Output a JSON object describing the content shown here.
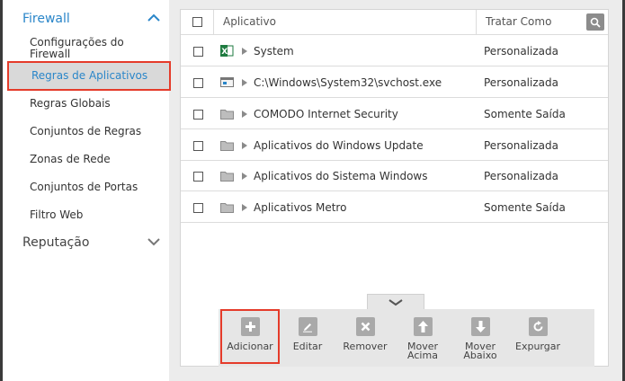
{
  "sidebar": {
    "firewall_title": "Firewall",
    "items": [
      {
        "label": "Configurações do Firewall"
      },
      {
        "label": "Regras de Aplicativos"
      },
      {
        "label": "Regras Globais"
      },
      {
        "label": "Conjuntos de Regras"
      },
      {
        "label": "Zonas de Rede"
      },
      {
        "label": "Conjuntos de Portas"
      },
      {
        "label": "Filtro Web"
      }
    ],
    "reputation_title": "Reputação"
  },
  "table": {
    "col_app": "Aplicativo",
    "col_treat": "Tratar Como",
    "rows": [
      {
        "name": "System",
        "treat": "Personalizada",
        "icon": "excel-icon"
      },
      {
        "name": "C:\\Windows\\System32\\svchost.exe",
        "treat": "Personalizada",
        "icon": "application-icon"
      },
      {
        "name": "COMODO Internet Security",
        "treat": "Somente Saída",
        "icon": "folder-icon"
      },
      {
        "name": "Aplicativos do Windows Update",
        "treat": "Personalizada",
        "icon": "folder-icon"
      },
      {
        "name": "Aplicativos do Sistema Windows",
        "treat": "Personalizada",
        "icon": "folder-icon"
      },
      {
        "name": "Aplicativos Metro",
        "treat": "Somente Saída",
        "icon": "folder-icon"
      }
    ]
  },
  "toolbar": {
    "add": "Adicionar",
    "edit": "Editar",
    "remove": "Remover",
    "move_up_1": "Mover",
    "move_up_2": "Acima",
    "move_down_1": "Mover",
    "move_down_2": "Abaixo",
    "purge": "Expurgar"
  },
  "colors": {
    "accent": "#2a86c9",
    "highlight": "#e53b2a"
  }
}
